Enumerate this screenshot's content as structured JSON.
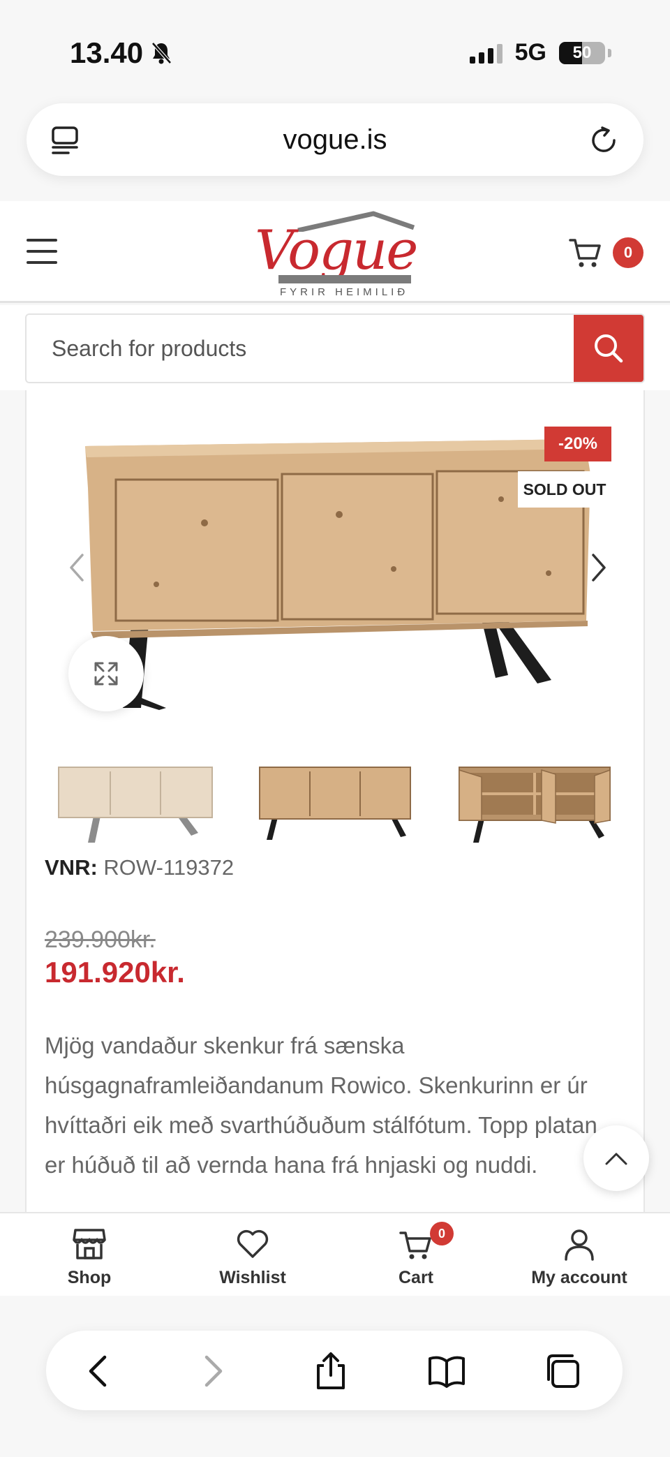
{
  "status_bar": {
    "time": "13.40",
    "network": "5G",
    "battery": "50",
    "battery_level": 0.5
  },
  "browser": {
    "url": "vogue.is"
  },
  "site": {
    "logo_text": "Vogue",
    "logo_tagline": "FYRIR HEIMILIÐ",
    "cart_count": "0",
    "search_placeholder": "Search for products"
  },
  "product": {
    "sale_badge": "-20%",
    "sold_badge": "SOLD OUT",
    "sku_label": "VNR:",
    "sku_value": "ROW-119372",
    "old_price": "239.900kr.",
    "new_price": "191.920kr.",
    "description": "Mjög vandaður skenkur frá sænska húsgagnaframleiðandanum Rowico. Skenkurinn er úr hvíttaðri eik með svarthúðuðum stálfótum. Topp platan er húðuð til að vernda hana frá hnjaski og nuddi."
  },
  "tabbar": {
    "shop": "Shop",
    "wishlist": "Wishlist",
    "cart": "Cart",
    "cart_count": "0",
    "account": "My account"
  },
  "colors": {
    "brand_red": "#d13a34",
    "price_red": "#c8292f",
    "wood": "#dcb88f"
  }
}
